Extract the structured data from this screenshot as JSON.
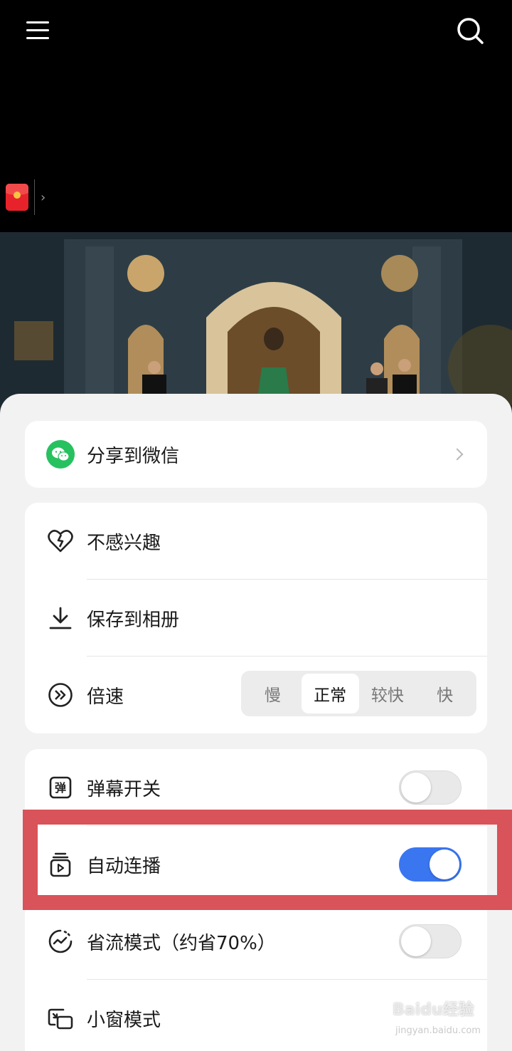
{
  "top_bar": {
    "menu_icon": "hamburger-menu-icon",
    "search_icon": "search-icon"
  },
  "red_packet": {
    "icon": "red-packet-icon",
    "chevron": "›"
  },
  "share": {
    "wechat_label": "分享到微信",
    "icon": "wechat-icon"
  },
  "actions": {
    "not_interested": "不感兴趣",
    "save_to_album": "保存到相册",
    "speed_label": "倍速",
    "speed_options": [
      "慢",
      "正常",
      "较快",
      "快"
    ],
    "speed_selected": "正常"
  },
  "toggles": {
    "danmaku": {
      "label": "弹幕开关",
      "on": false,
      "icon_text": "弹"
    },
    "autoplay": {
      "label": "自动连播",
      "on": true
    },
    "data_saver": {
      "label": "省流模式（约省70%）",
      "on": false
    },
    "mini_window": {
      "label": "小窗模式"
    }
  },
  "colors": {
    "accent": "#3a76f0",
    "wechat": "#27c160",
    "highlight": "#d9535a"
  },
  "watermark": {
    "text": "Baidu经验",
    "sub": "jingyan.baidu.com"
  }
}
